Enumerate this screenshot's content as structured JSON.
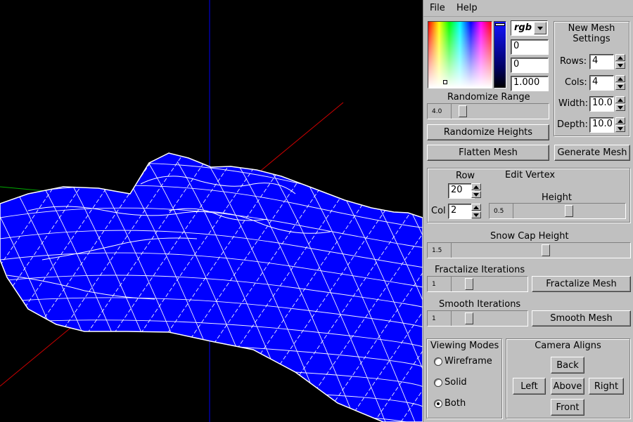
{
  "menubar": {
    "file": "File",
    "help": "Help"
  },
  "color": {
    "mode": "rgb",
    "fields": [
      "0",
      "0",
      "1.000"
    ],
    "mesh_color": "#0000ff",
    "wire_color": "#ffffff"
  },
  "randomize": {
    "range_label": "Randomize Range",
    "range_value": "4.0",
    "heights_button": "Randomize Heights",
    "flatten_button": "Flatten Mesh"
  },
  "new_mesh": {
    "title_line1": "New Mesh",
    "title_line2": "Settings",
    "rows_label": "Rows:",
    "rows_value": "4",
    "cols_label": "Cols:",
    "cols_value": "4",
    "width_label": "Width:",
    "width_value": "10.0",
    "depth_label": "Depth:",
    "depth_value": "10.0",
    "generate_button": "Generate Mesh"
  },
  "edit_vertex": {
    "title": "Edit Vertex",
    "row_label": "Row",
    "row_value": "20",
    "col_label": "Col",
    "col_value": "2",
    "height_label": "Height",
    "height_value": "0.5"
  },
  "snow_cap": {
    "label": "Snow Cap Height",
    "value": "1.5"
  },
  "fractalize": {
    "label": "Fractalize Iterations",
    "value": "1",
    "button": "Fractalize Mesh"
  },
  "smooth": {
    "label": "Smooth Iterations",
    "value": "1",
    "button": "Smooth Mesh"
  },
  "viewing_modes": {
    "title": "Viewing Modes",
    "options": [
      "Wireframe",
      "Solid",
      "Both"
    ],
    "selected": "Both"
  },
  "camera": {
    "title": "Camera Aligns",
    "back": "Back",
    "left": "Left",
    "above": "Above",
    "right": "Right",
    "front": "Front"
  },
  "axes": {
    "x_color": "#cc0000",
    "y_color": "#0000cc",
    "z_color": "#00aa00"
  }
}
